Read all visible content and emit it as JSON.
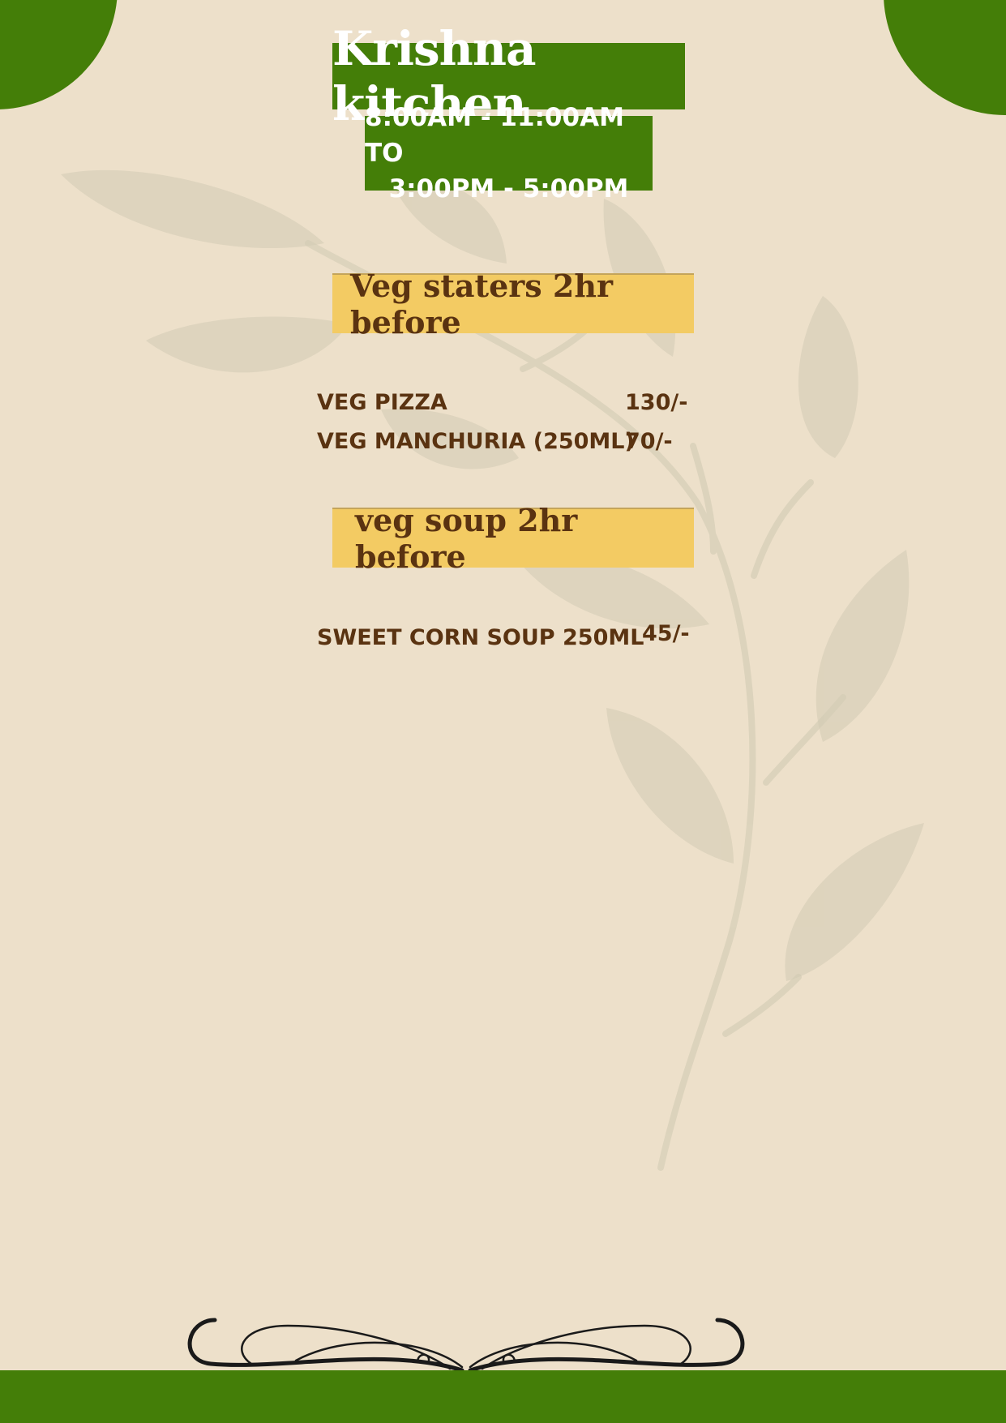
{
  "header": {
    "title": "Krishna kitchen",
    "hours_line1": "8:00AM - 11:00AM TO",
    "hours_line2": "3:00PM - 5:00PM"
  },
  "sections": [
    {
      "title": "Veg staters 2hr before",
      "items": [
        {
          "name": "VEG PIZZA",
          "price": "130/-"
        },
        {
          "name": "VEG MANCHURIA (250ML)",
          "price": "70/-"
        }
      ]
    },
    {
      "title": "veg soup 2hr before",
      "items": [
        {
          "name": "SWEET CORN SOUP 250ML",
          "price": "45/-"
        }
      ]
    }
  ],
  "colors": {
    "background": "#ede0ca",
    "green": "#447e08",
    "yellow": "#f3cb63",
    "brown_text": "#5a3311"
  }
}
